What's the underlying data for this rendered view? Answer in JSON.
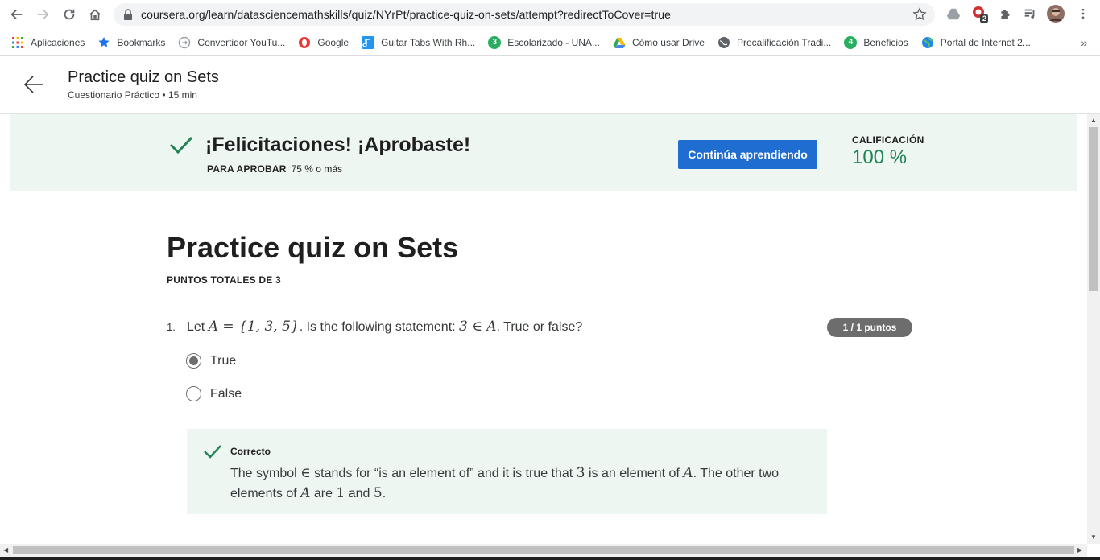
{
  "browser": {
    "url_host": "coursera.org",
    "url_path": "/learn/datasciencemathskills/quiz/NYrPt/practice-quiz-on-sets/attempt?redirectToCover=true",
    "extension_badge": "2",
    "bookmarks": [
      {
        "label": "Aplicaciones",
        "icon": "apps-grid-icon",
        "color": "#4285f4"
      },
      {
        "label": "Bookmarks",
        "icon": "star-icon",
        "color": "#1a73e8"
      },
      {
        "label": "Convertidor YouTu...",
        "icon": "convert-icon",
        "color": "#9aa0a6"
      },
      {
        "label": "Google",
        "icon": "opera-icon",
        "color": "#e53935"
      },
      {
        "label": "Guitar Tabs With Rh...",
        "icon": "guitar-icon",
        "color": "#2196f3"
      },
      {
        "label": "Escolarizado - UNA...",
        "icon": "badge-3-icon",
        "color": "#27ae60"
      },
      {
        "label": "Cómo usar Drive",
        "icon": "drive-icon",
        "color": "#fbbc04"
      },
      {
        "label": "Precalificación Tradi...",
        "icon": "globe-icon",
        "color": "#5f6368"
      },
      {
        "label": "Beneficios",
        "icon": "badge-4-icon",
        "color": "#27ae60"
      },
      {
        "label": "Portal de Internet 2...",
        "icon": "earth-icon",
        "color": "#1e88e5"
      }
    ]
  },
  "header": {
    "title": "Practice quiz on Sets",
    "subtitle": "Cuestionario Práctico • 15 min"
  },
  "banner": {
    "title": "¡Felicitaciones! ¡Aprobaste!",
    "pass_label": "PARA APROBAR",
    "pass_value": "75 % o más",
    "continue_label": "Continúa aprendiendo",
    "grade_label": "CALIFICACIÓN",
    "grade_value": "100 %"
  },
  "quiz": {
    "title": "Practice quiz on Sets",
    "total_points_label": "PUNTOS TOTALES DE 3",
    "questions": [
      {
        "number": "1.",
        "text_prefix": "Let ",
        "text_math_set": "A = {1, 3, 5}",
        "text_middle": ". Is the following statement: ",
        "text_math_stmt": "3 ∈ A",
        "text_suffix": ". True or false?",
        "points": "1 / 1 puntos",
        "options": [
          {
            "label": "True",
            "selected": true
          },
          {
            "label": "False",
            "selected": false
          }
        ],
        "feedback_title": "Correcto",
        "feedback_text_1": "The symbol ",
        "feedback_sym": "∈",
        "feedback_text_2": " stands for “is an element of” and it is true that ",
        "feedback_m3": "3",
        "feedback_text_3": " is an element of ",
        "feedback_mA": "A",
        "feedback_text_4": ". The other two elements of ",
        "feedback_mA2": "A",
        "feedback_text_5": " are ",
        "feedback_m1": "1",
        "feedback_text_6": " and ",
        "feedback_m5": "5",
        "feedback_text_7": "."
      }
    ]
  },
  "colors": {
    "success_green": "#1f8354",
    "banner_bg": "#eef6f2",
    "primary_blue": "#1f6dd0"
  }
}
